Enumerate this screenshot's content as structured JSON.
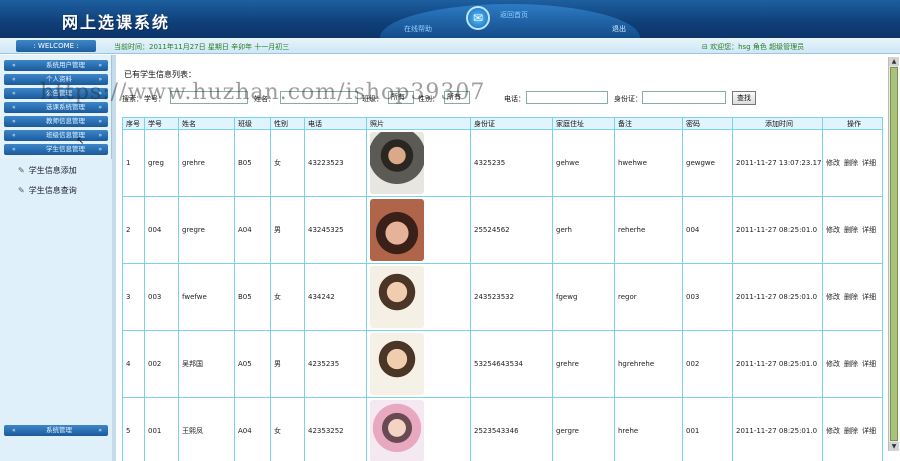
{
  "header": {
    "title": "网上选课系统",
    "mail_icon": "mail-icon",
    "link_left": "在线帮助",
    "link_right": "返回首页",
    "logout": "退出"
  },
  "infobar": {
    "welcome": "WELCOME",
    "datetime": "当前时间：2011年11月27日  星期日  辛卯年  十一月初三",
    "user": "欢迎您：hsg  角色  超级管理员"
  },
  "sidebar": {
    "items": [
      {
        "label": "系统用户管理"
      },
      {
        "label": "个人资料"
      },
      {
        "label": "公告管理"
      },
      {
        "label": "选课系统管理"
      },
      {
        "label": "教师信息管理"
      },
      {
        "label": "班级信息管理"
      },
      {
        "label": "学生信息管理"
      }
    ],
    "sub_links": [
      {
        "label": "学生信息添加"
      },
      {
        "label": "学生信息查询"
      }
    ],
    "bottom_item": "系统管理"
  },
  "main": {
    "section_title": "已有学生信息列表：",
    "search": {
      "label_search": "搜索：",
      "label_sno": "学号：",
      "label_name": "姓名：",
      "label_class": "班级：",
      "class_value": "所有",
      "label_sex": "性别：",
      "sex_value": "所有",
      "label_phone": "电话：",
      "label_idcard": "身份证：",
      "button": "查找"
    },
    "columns": [
      "序号",
      "学号",
      "姓名",
      "班级",
      "性别",
      "电话",
      "照片",
      "身份证",
      "家庭住址",
      "备注",
      "密码",
      "添加时间",
      "操作"
    ],
    "rows": [
      {
        "no": "1",
        "sno": "greg",
        "name": "grehre",
        "cls": "B05",
        "sex": "女",
        "phone": "43223523",
        "idcard": "4325235",
        "addr": "gehwe",
        "note": "hwehwe",
        "pwd": "gewgwe",
        "time": "2011-11-27 13:07:23.17"
      },
      {
        "no": "2",
        "sno": "004",
        "name": "gregre",
        "cls": "A04",
        "sex": "男",
        "phone": "43245325",
        "idcard": "25524562",
        "addr": "gerh",
        "note": "reherhe",
        "pwd": "004",
        "time": "2011-11-27 08:25:01.0"
      },
      {
        "no": "3",
        "sno": "003",
        "name": "fwefwe",
        "cls": "B05",
        "sex": "女",
        "phone": "434242",
        "idcard": "243523532",
        "addr": "fgewg",
        "note": "regor",
        "pwd": "003",
        "time": "2011-11-27 08:25:01.0"
      },
      {
        "no": "4",
        "sno": "002",
        "name": "吴邦国",
        "cls": "A05",
        "sex": "男",
        "phone": "4235235",
        "idcard": "53254643534",
        "addr": "grehre",
        "note": "hgrehrehe",
        "pwd": "002",
        "time": "2011-11-27 08:25:01.0"
      },
      {
        "no": "5",
        "sno": "001",
        "name": "王熙凤",
        "cls": "A04",
        "sex": "女",
        "phone": "42353252",
        "idcard": "2523543346",
        "addr": "gergre",
        "note": "hrehe",
        "pwd": "001",
        "time": "2011-11-27 08:25:01.0"
      }
    ],
    "ops": [
      "修改",
      "删除",
      "详细"
    ]
  },
  "watermark": "https://www.huzhan.com/ishop39307",
  "colors": {
    "banner": "#0f3f78",
    "menu": "#1a5a9c",
    "grid_border": "#7cd2ee",
    "header_bg": "#dff4fc",
    "status_text": "#2a7a22",
    "scroll_thumb": "#a9c27c"
  }
}
